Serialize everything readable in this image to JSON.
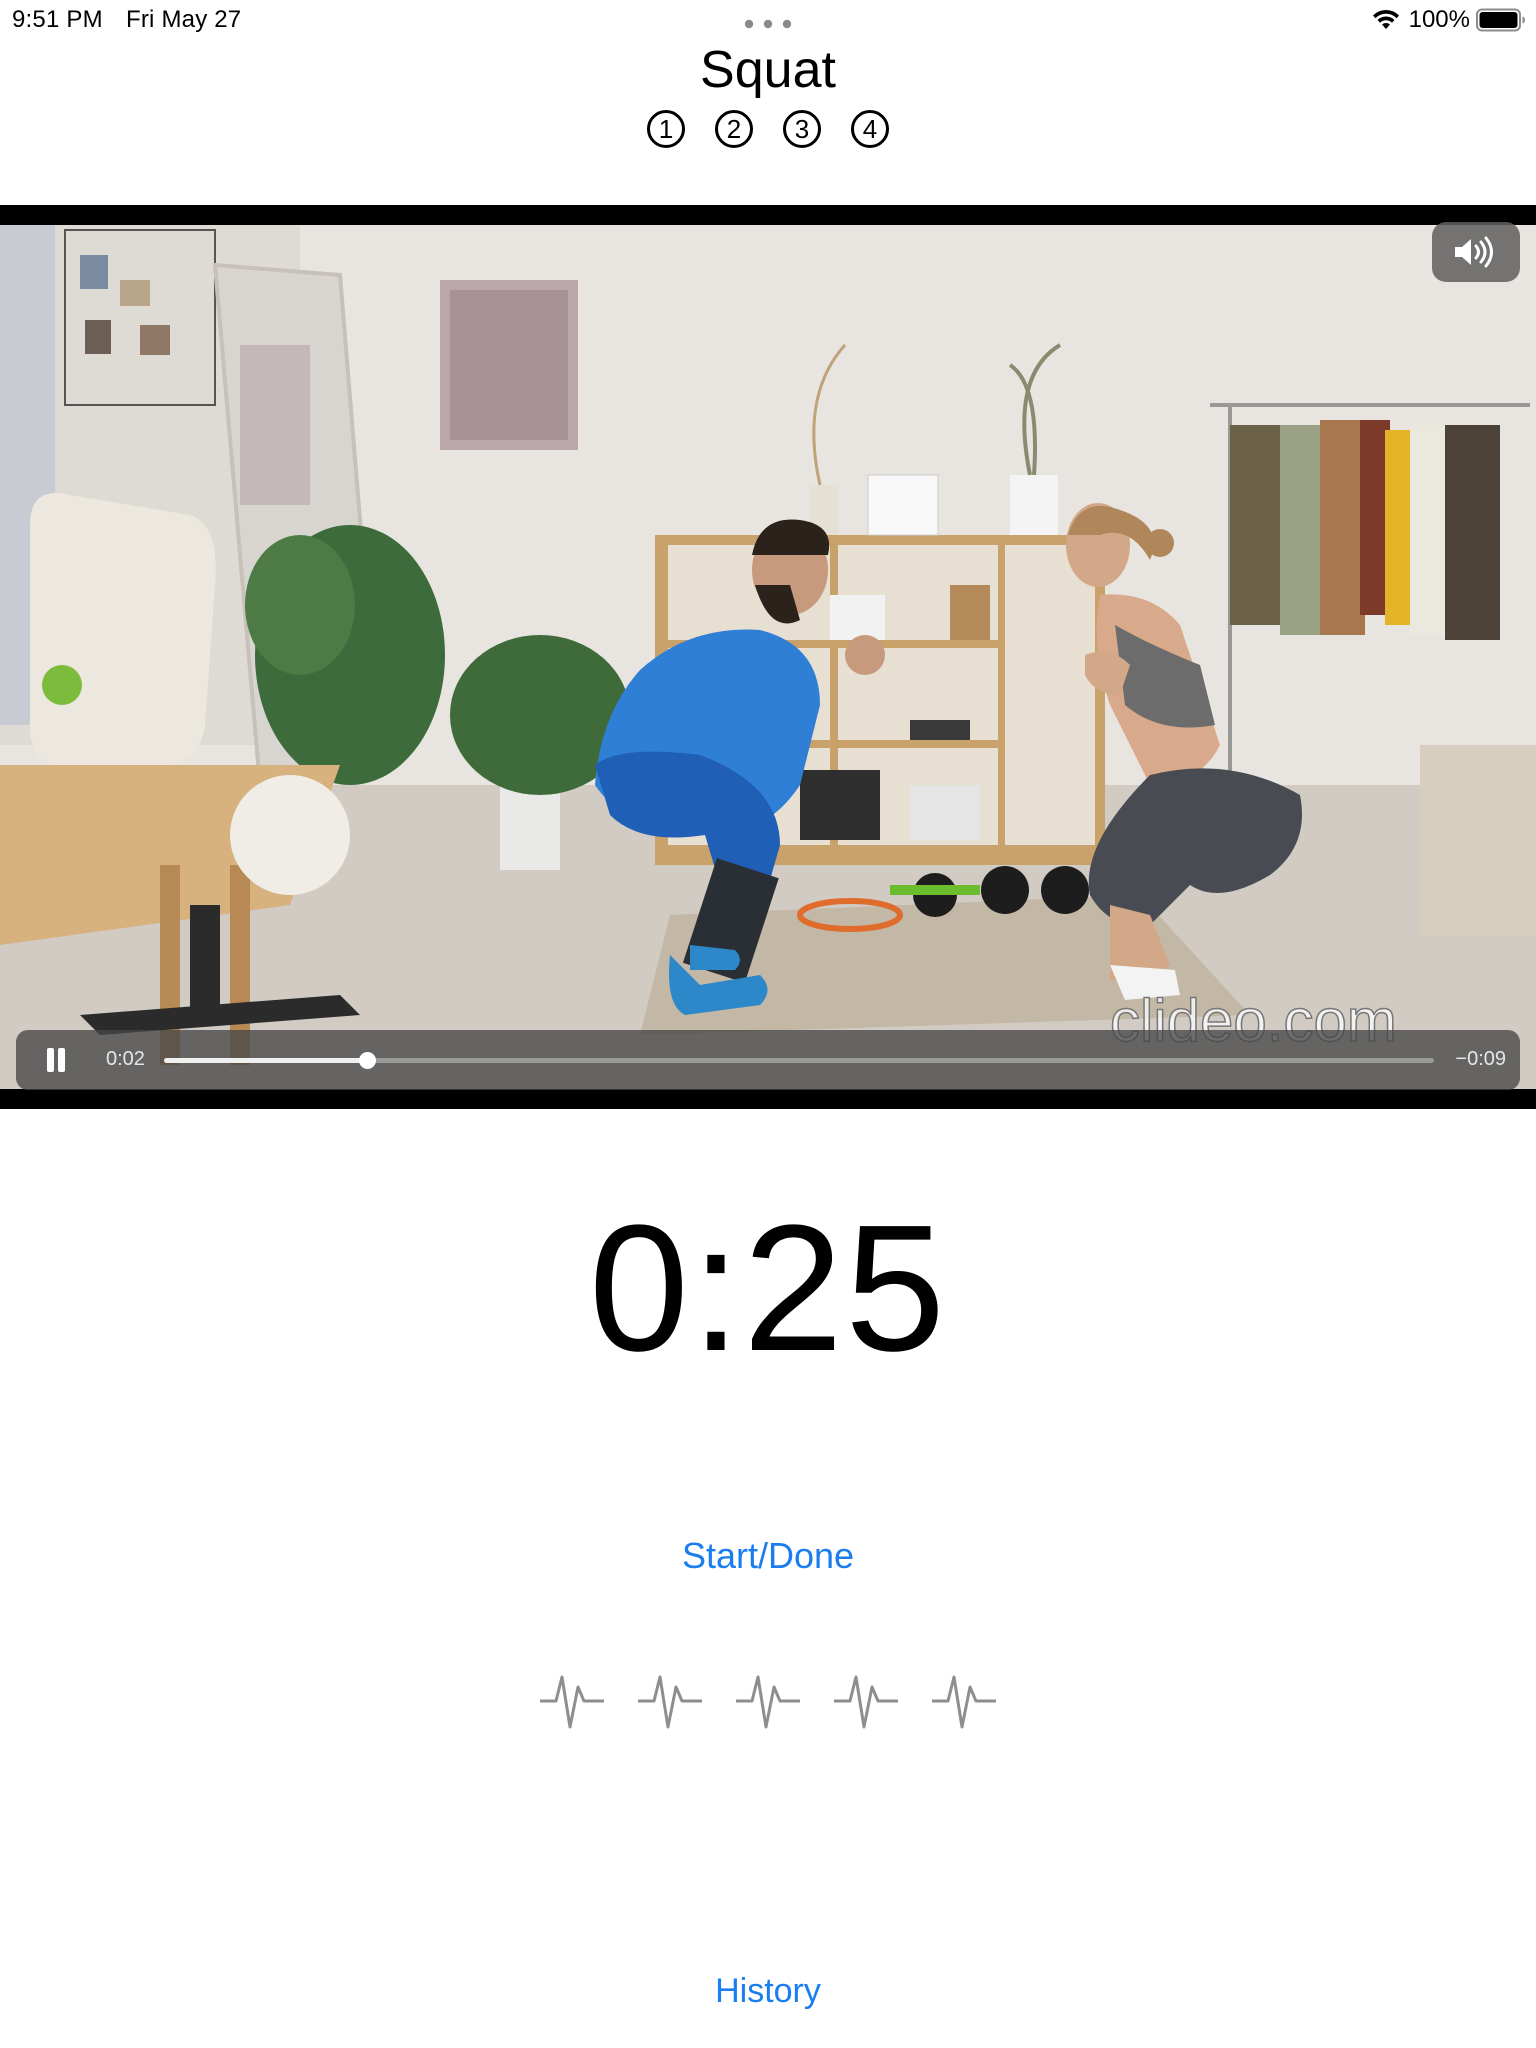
{
  "status_bar": {
    "time": "9:51 PM",
    "date": "Fri May 27",
    "battery_percent": "100%",
    "wifi_icon": "wifi-icon",
    "battery_icon": "battery-icon"
  },
  "exercise": {
    "title": "Squat",
    "steps": [
      "1",
      "2",
      "3",
      "4"
    ]
  },
  "video": {
    "watermark": "clideo.com",
    "elapsed": "0:02",
    "remaining": "−0:09",
    "progress_fraction": 0.16,
    "pause_icon": "pause-icon",
    "volume_icon": "speaker-volume-icon"
  },
  "timer": {
    "display": "0:25"
  },
  "actions": {
    "start_done_label": "Start/Done",
    "history_label": "History"
  },
  "pulse_icons": [
    "heart-rate-icon",
    "heart-rate-icon",
    "heart-rate-icon",
    "heart-rate-icon",
    "heart-rate-icon"
  ],
  "colors": {
    "accent": "#1a7df0",
    "pulse_icon": "#8e8e8e"
  }
}
